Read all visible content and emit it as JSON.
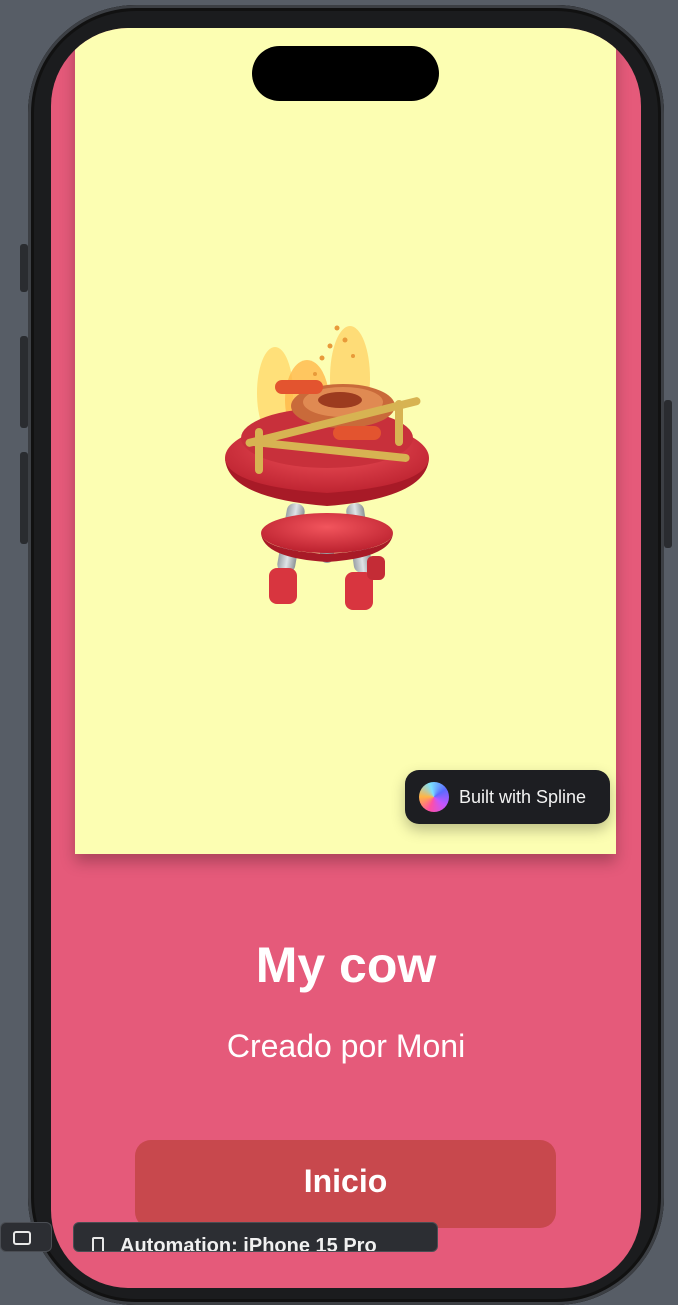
{
  "scene": {
    "badge_label": "Built with Spline",
    "background_color": "#fcfeb2",
    "illustration": "barbecue-grill-3d"
  },
  "content": {
    "title": "My cow",
    "subtitle": "Creado por Moni",
    "start_label": "Inicio"
  },
  "colors": {
    "screen_background": "#e55a7a",
    "button": "#c8484d",
    "badge": "#1d1e22"
  },
  "taskbar": {
    "tab_label": "Automation: iPhone 15 Pro"
  }
}
